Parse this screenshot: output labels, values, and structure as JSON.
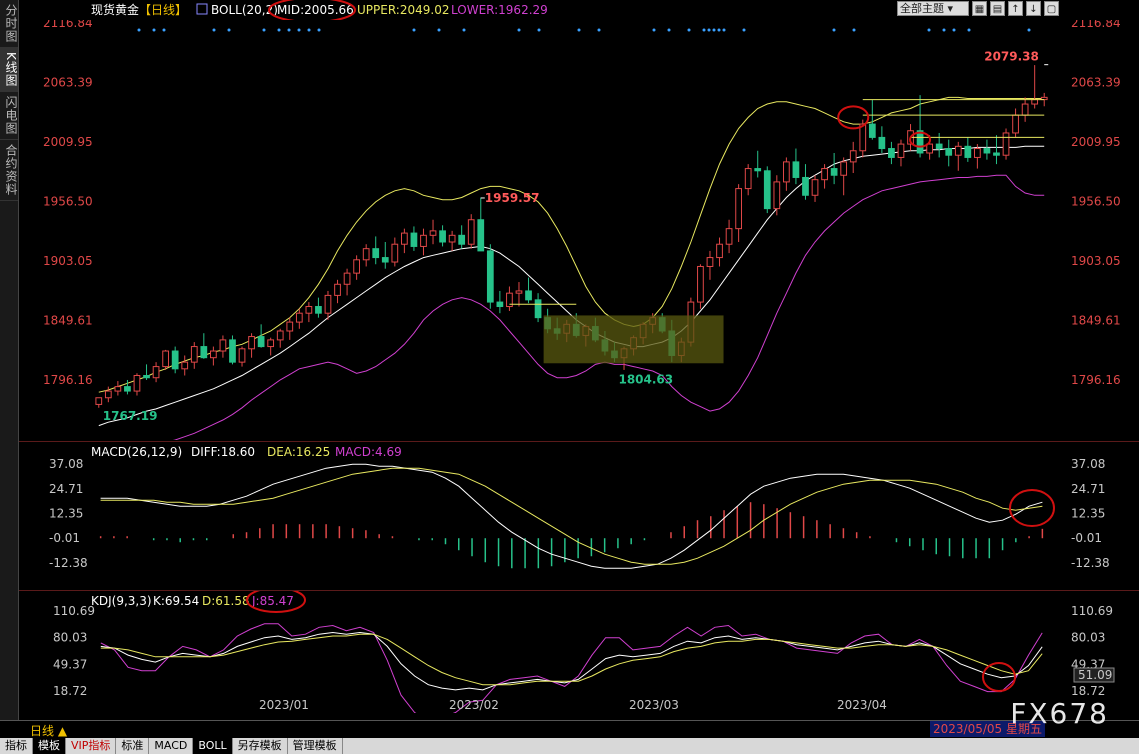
{
  "left_tabs": [
    "分时图",
    "K线图",
    "闪电图",
    "合约资料"
  ],
  "left_tab_active": 1,
  "topbar": {
    "symbol": "现货黄金",
    "period": "【日线】",
    "boll_name": "BOLL(20,2)",
    "mid": "MID:2005.66",
    "upper": "UPPER:2049.02",
    "lower": "LOWER:1962.29",
    "theme_select": "全部主题"
  },
  "colors": {
    "up": "#e04848",
    "down": "#26c28a",
    "mid": "#ffffff",
    "upper": "#e8e860",
    "lower": "#d040d0",
    "annotation": "#d01010"
  },
  "price_axis_labels": [
    "2116.84",
    "2063.39",
    "2009.95",
    "1956.50",
    "1903.05",
    "1849.61",
    "1796.16"
  ],
  "price_annotations": {
    "high": "2079.38",
    "feb_high": "1959.57",
    "mar_low": "1804.63",
    "dec_low": "1767.19"
  },
  "macd": {
    "name": "MACD(26,12,9)",
    "diff": "DIFF:18.60",
    "dea": "DEA:16.25",
    "macd": "MACD:4.69",
    "axis_labels": [
      "37.08",
      "24.71",
      "12.35",
      "-0.01",
      "-12.38"
    ]
  },
  "kdj": {
    "name": "KDJ(9,3,3)",
    "k": "K:69.54",
    "d": "D:61.58",
    "j": "J:85.47",
    "axis_labels": [
      "110.69",
      "80.03",
      "49.37",
      "18.72"
    ],
    "cursor_value": "51.09"
  },
  "x_axis_labels": [
    "2023/01",
    "2023/02",
    "2023/03",
    "2023/04"
  ],
  "bottom": {
    "period": "日线",
    "cursor_date": "2023/05/05 星期五",
    "tabs": [
      "指标",
      "模板",
      "VIP指标",
      "标准",
      "MACD",
      "BOLL",
      "另存模板",
      "管理模板"
    ],
    "active_tabs": [
      1,
      5
    ],
    "vip_tab": 2
  },
  "watermark": "FX678",
  "chart_data": {
    "type": "candlestick",
    "title": "现货黄金 日线",
    "ylim": [
      1767,
      2117
    ],
    "candles": [
      [
        1774,
        1780,
        1771,
        1780
      ],
      [
        1780,
        1790,
        1776,
        1786
      ],
      [
        1786,
        1795,
        1782,
        1790
      ],
      [
        1790,
        1796,
        1783,
        1786
      ],
      [
        1786,
        1802,
        1782,
        1800
      ],
      [
        1800,
        1810,
        1796,
        1798
      ],
      [
        1798,
        1812,
        1794,
        1808
      ],
      [
        1808,
        1823,
        1805,
        1822
      ],
      [
        1822,
        1826,
        1802,
        1806
      ],
      [
        1806,
        1818,
        1800,
        1812
      ],
      [
        1812,
        1830,
        1806,
        1826
      ],
      [
        1826,
        1838,
        1815,
        1816
      ],
      [
        1816,
        1826,
        1809,
        1822
      ],
      [
        1822,
        1836,
        1816,
        1832
      ],
      [
        1832,
        1836,
        1810,
        1812
      ],
      [
        1812,
        1826,
        1808,
        1824
      ],
      [
        1824,
        1838,
        1816,
        1835
      ],
      [
        1835,
        1846,
        1825,
        1826
      ],
      [
        1826,
        1834,
        1818,
        1832
      ],
      [
        1832,
        1842,
        1825,
        1840
      ],
      [
        1840,
        1852,
        1832,
        1848
      ],
      [
        1848,
        1860,
        1842,
        1856
      ],
      [
        1856,
        1866,
        1848,
        1862
      ],
      [
        1862,
        1870,
        1852,
        1856
      ],
      [
        1856,
        1876,
        1850,
        1872
      ],
      [
        1872,
        1886,
        1865,
        1882
      ],
      [
        1882,
        1896,
        1872,
        1892
      ],
      [
        1892,
        1908,
        1886,
        1904
      ],
      [
        1904,
        1918,
        1898,
        1914
      ],
      [
        1914,
        1925,
        1900,
        1906
      ],
      [
        1906,
        1920,
        1896,
        1902
      ],
      [
        1902,
        1924,
        1898,
        1918
      ],
      [
        1918,
        1932,
        1910,
        1928
      ],
      [
        1928,
        1934,
        1912,
        1916
      ],
      [
        1916,
        1932,
        1908,
        1926
      ],
      [
        1926,
        1940,
        1918,
        1930
      ],
      [
        1930,
        1935,
        1916,
        1920
      ],
      [
        1920,
        1930,
        1912,
        1926
      ],
      [
        1926,
        1935,
        1914,
        1918
      ],
      [
        1918,
        1945,
        1914,
        1940
      ],
      [
        1940,
        1960,
        1920,
        1912
      ],
      [
        1912,
        1918,
        1860,
        1866
      ],
      [
        1866,
        1876,
        1856,
        1862
      ],
      [
        1862,
        1880,
        1858,
        1874
      ],
      [
        1874,
        1884,
        1862,
        1876
      ],
      [
        1876,
        1888,
        1865,
        1868
      ],
      [
        1868,
        1874,
        1848,
        1852
      ],
      [
        1852,
        1860,
        1838,
        1842
      ],
      [
        1842,
        1852,
        1832,
        1838
      ],
      [
        1838,
        1850,
        1830,
        1846
      ],
      [
        1846,
        1856,
        1834,
        1836
      ],
      [
        1836,
        1846,
        1826,
        1844
      ],
      [
        1844,
        1852,
        1830,
        1832
      ],
      [
        1832,
        1840,
        1818,
        1822
      ],
      [
        1822,
        1830,
        1812,
        1816
      ],
      [
        1816,
        1826,
        1805,
        1824
      ],
      [
        1824,
        1836,
        1818,
        1834
      ],
      [
        1834,
        1848,
        1828,
        1846
      ],
      [
        1846,
        1856,
        1838,
        1852
      ],
      [
        1852,
        1856,
        1838,
        1840
      ],
      [
        1840,
        1850,
        1812,
        1818
      ],
      [
        1818,
        1834,
        1812,
        1830
      ],
      [
        1830,
        1870,
        1826,
        1866
      ],
      [
        1866,
        1900,
        1860,
        1898
      ],
      [
        1898,
        1912,
        1886,
        1906
      ],
      [
        1906,
        1924,
        1898,
        1918
      ],
      [
        1918,
        1940,
        1910,
        1932
      ],
      [
        1932,
        1972,
        1920,
        1968
      ],
      [
        1968,
        1990,
        1962,
        1986
      ],
      [
        1986,
        2002,
        1978,
        1984
      ],
      [
        1984,
        1988,
        1946,
        1950
      ],
      [
        1950,
        1980,
        1944,
        1974
      ],
      [
        1974,
        1996,
        1966,
        1992
      ],
      [
        1992,
        2004,
        1972,
        1978
      ],
      [
        1978,
        1990,
        1958,
        1962
      ],
      [
        1962,
        1980,
        1956,
        1976
      ],
      [
        1976,
        1990,
        1968,
        1986
      ],
      [
        1986,
        2000,
        1972,
        1980
      ],
      [
        1980,
        1996,
        1962,
        1992
      ],
      [
        1992,
        2010,
        1982,
        2002
      ],
      [
        2002,
        2030,
        1996,
        2026
      ],
      [
        2026,
        2048,
        2012,
        2014
      ],
      [
        2014,
        2024,
        2000,
        2004
      ],
      [
        2004,
        2010,
        1990,
        1996
      ],
      [
        1996,
        2012,
        1988,
        2008
      ],
      [
        2008,
        2026,
        2002,
        2020
      ],
      [
        2020,
        2052,
        1996,
        2000
      ],
      [
        2000,
        2016,
        1994,
        2008
      ],
      [
        2008,
        2018,
        1996,
        2004
      ],
      [
        2004,
        2012,
        1988,
        1998
      ],
      [
        1998,
        2010,
        1984,
        2006
      ],
      [
        2006,
        2014,
        1992,
        1996
      ],
      [
        1996,
        2008,
        1986,
        2004
      ],
      [
        2004,
        2012,
        1994,
        2000
      ],
      [
        2000,
        2016,
        1990,
        1998
      ],
      [
        1998,
        2022,
        1994,
        2018
      ],
      [
        2018,
        2040,
        2014,
        2034
      ],
      [
        2034,
        2050,
        2028,
        2044
      ],
      [
        2044,
        2079,
        2040,
        2048
      ],
      [
        2048,
        2054,
        2042,
        2050
      ]
    ],
    "boll_upper": [
      1785,
      1787,
      1790,
      1793,
      1796,
      1799,
      1803,
      1806,
      1810,
      1813,
      1816,
      1818,
      1821,
      1823,
      1826,
      1828,
      1832,
      1836,
      1840,
      1846,
      1852,
      1860,
      1870,
      1882,
      1896,
      1912,
      1926,
      1938,
      1948,
      1956,
      1962,
      1966,
      1968,
      1966,
      1962,
      1960,
      1958,
      1958,
      1960,
      1964,
      1968,
      1970,
      1970,
      1968,
      1966,
      1962,
      1956,
      1946,
      1932,
      1916,
      1898,
      1880,
      1866,
      1856,
      1850,
      1846,
      1844,
      1846,
      1852,
      1862,
      1878,
      1898,
      1920,
      1944,
      1968,
      1990,
      2008,
      2022,
      2032,
      2040,
      2044,
      2046,
      2046,
      2044,
      2042,
      2040,
      2036,
      2032,
      2028,
      2026,
      2026,
      2028,
      2032,
      2036,
      2038,
      2040,
      2044,
      2046,
      2048,
      2050,
      2050,
      2049,
      2049,
      2049,
      2049,
      2049,
      2049,
      2049,
      2049,
      2049
    ],
    "boll_mid": [
      1755,
      1758,
      1760,
      1762,
      1765,
      1768,
      1770,
      1773,
      1776,
      1779,
      1782,
      1785,
      1788,
      1792,
      1796,
      1800,
      1805,
      1810,
      1815,
      1820,
      1826,
      1832,
      1838,
      1845,
      1852,
      1858,
      1864,
      1870,
      1876,
      1882,
      1888,
      1893,
      1898,
      1902,
      1906,
      1908,
      1910,
      1912,
      1914,
      1915,
      1916,
      1914,
      1910,
      1904,
      1898,
      1890,
      1882,
      1874,
      1866,
      1858,
      1850,
      1844,
      1838,
      1834,
      1830,
      1828,
      1826,
      1826,
      1828,
      1830,
      1834,
      1840,
      1848,
      1858,
      1868,
      1880,
      1892,
      1904,
      1916,
      1928,
      1940,
      1950,
      1960,
      1968,
      1975,
      1980,
      1985,
      1990,
      1993,
      1995,
      1997,
      1998,
      1999,
      2000,
      2001,
      2002,
      2002,
      2003,
      2003,
      2004,
      2004,
      2004,
      2005,
      2005,
      2005,
      2005,
      2005,
      2006,
      2006,
      2006
    ],
    "boll_lower": [
      1725,
      1728,
      1730,
      1732,
      1733,
      1735,
      1737,
      1740,
      1742,
      1745,
      1748,
      1752,
      1756,
      1760,
      1765,
      1771,
      1778,
      1784,
      1790,
      1796,
      1801,
      1806,
      1808,
      1810,
      1812,
      1810,
      1806,
      1802,
      1804,
      1808,
      1814,
      1820,
      1828,
      1838,
      1850,
      1858,
      1864,
      1868,
      1870,
      1868,
      1864,
      1858,
      1850,
      1840,
      1830,
      1820,
      1810,
      1802,
      1798,
      1798,
      1800,
      1804,
      1810,
      1812,
      1810,
      1810,
      1808,
      1806,
      1804,
      1800,
      1790,
      1782,
      1776,
      1772,
      1768,
      1770,
      1776,
      1786,
      1800,
      1816,
      1836,
      1856,
      1874,
      1892,
      1908,
      1920,
      1930,
      1938,
      1946,
      1952,
      1958,
      1962,
      1966,
      1968,
      1970,
      1972,
      1974,
      1975,
      1976,
      1977,
      1978,
      1978,
      1979,
      1979,
      1980,
      1980,
      1970,
      1964,
      1962,
      1962
    ],
    "macd_diff": [
      20,
      20,
      20,
      19,
      18,
      17,
      16,
      16,
      16,
      17,
      19,
      21,
      24,
      27,
      29,
      31,
      33,
      35,
      36,
      37,
      37,
      36,
      36,
      35,
      34,
      33,
      30,
      26,
      20,
      14,
      8,
      3,
      -1,
      -5,
      -8,
      -10,
      -12,
      -14,
      -15,
      -15,
      -15,
      -14,
      -13,
      -10,
      -6,
      -1,
      4,
      10,
      16,
      22,
      26,
      28,
      30,
      31,
      32,
      32,
      32,
      31,
      30,
      29,
      27,
      25,
      22,
      19,
      16,
      13,
      10,
      8,
      9,
      12,
      16,
      18
    ],
    "macd_dea": [
      19,
      19,
      19,
      19,
      19,
      18,
      18,
      17,
      17,
      17,
      17,
      18,
      19,
      20,
      22,
      24,
      26,
      28,
      30,
      32,
      33,
      34,
      35,
      35,
      35,
      34,
      33,
      32,
      29,
      26,
      22,
      18,
      14,
      10,
      6,
      2,
      -2,
      -5,
      -8,
      -10,
      -12,
      -13,
      -13,
      -13,
      -12,
      -10,
      -7,
      -4,
      0,
      4,
      9,
      13,
      17,
      20,
      23,
      25,
      27,
      28,
      29,
      29,
      29,
      29,
      28,
      27,
      25,
      23,
      20,
      18,
      15,
      14,
      15,
      16
    ],
    "macd_hist": [
      1,
      1,
      1,
      0,
      -1,
      -1,
      -2,
      -1,
      -1,
      0,
      2,
      3,
      5,
      7,
      7,
      7,
      7,
      7,
      6,
      5,
      4,
      2,
      1,
      0,
      -1,
      -1,
      -3,
      -6,
      -9,
      -12,
      -14,
      -15,
      -15,
      -15,
      -14,
      -12,
      -10,
      -9,
      -7,
      -5,
      -3,
      -1,
      0,
      3,
      6,
      9,
      11,
      14,
      16,
      18,
      17,
      15,
      13,
      11,
      9,
      7,
      5,
      3,
      1,
      0,
      -2,
      -4,
      -6,
      -8,
      -9,
      -10,
      -10,
      -10,
      -6,
      -2,
      1,
      4.69
    ],
    "kdj_k": [
      70,
      68,
      60,
      55,
      52,
      58,
      62,
      60,
      58,
      62,
      70,
      75,
      80,
      82,
      78,
      80,
      84,
      86,
      84,
      86,
      84,
      70,
      50,
      36,
      26,
      22,
      20,
      22,
      20,
      26,
      28,
      30,
      32,
      30,
      28,
      32,
      44,
      56,
      60,
      58,
      60,
      62,
      70,
      76,
      74,
      80,
      82,
      78,
      80,
      78,
      76,
      72,
      70,
      68,
      66,
      70,
      74,
      76,
      72,
      70,
      74,
      70,
      60,
      50,
      44,
      38,
      34,
      36,
      48,
      69.54
    ],
    "kdj_d": [
      68,
      68,
      66,
      62,
      58,
      58,
      58,
      58,
      58,
      60,
      64,
      68,
      72,
      75,
      76,
      78,
      80,
      82,
      82,
      84,
      84,
      78,
      68,
      58,
      48,
      40,
      34,
      30,
      26,
      26,
      26,
      28,
      30,
      30,
      30,
      30,
      36,
      44,
      50,
      54,
      56,
      58,
      64,
      68,
      70,
      74,
      76,
      76,
      78,
      78,
      76,
      74,
      72,
      70,
      68,
      68,
      70,
      72,
      72,
      70,
      72,
      70,
      66,
      60,
      54,
      48,
      42,
      38,
      42,
      61.58
    ],
    "kdj_j": [
      74,
      66,
      46,
      42,
      42,
      58,
      70,
      66,
      58,
      66,
      82,
      90,
      96,
      96,
      82,
      84,
      92,
      94,
      88,
      92,
      86,
      54,
      14,
      -6,
      -16,
      -12,
      -6,
      6,
      8,
      26,
      32,
      34,
      36,
      30,
      24,
      36,
      60,
      80,
      80,
      66,
      68,
      70,
      82,
      92,
      82,
      92,
      94,
      82,
      84,
      78,
      76,
      68,
      66,
      64,
      62,
      74,
      82,
      84,
      72,
      70,
      78,
      70,
      48,
      30,
      24,
      18,
      18,
      32,
      60,
      85.47
    ]
  }
}
